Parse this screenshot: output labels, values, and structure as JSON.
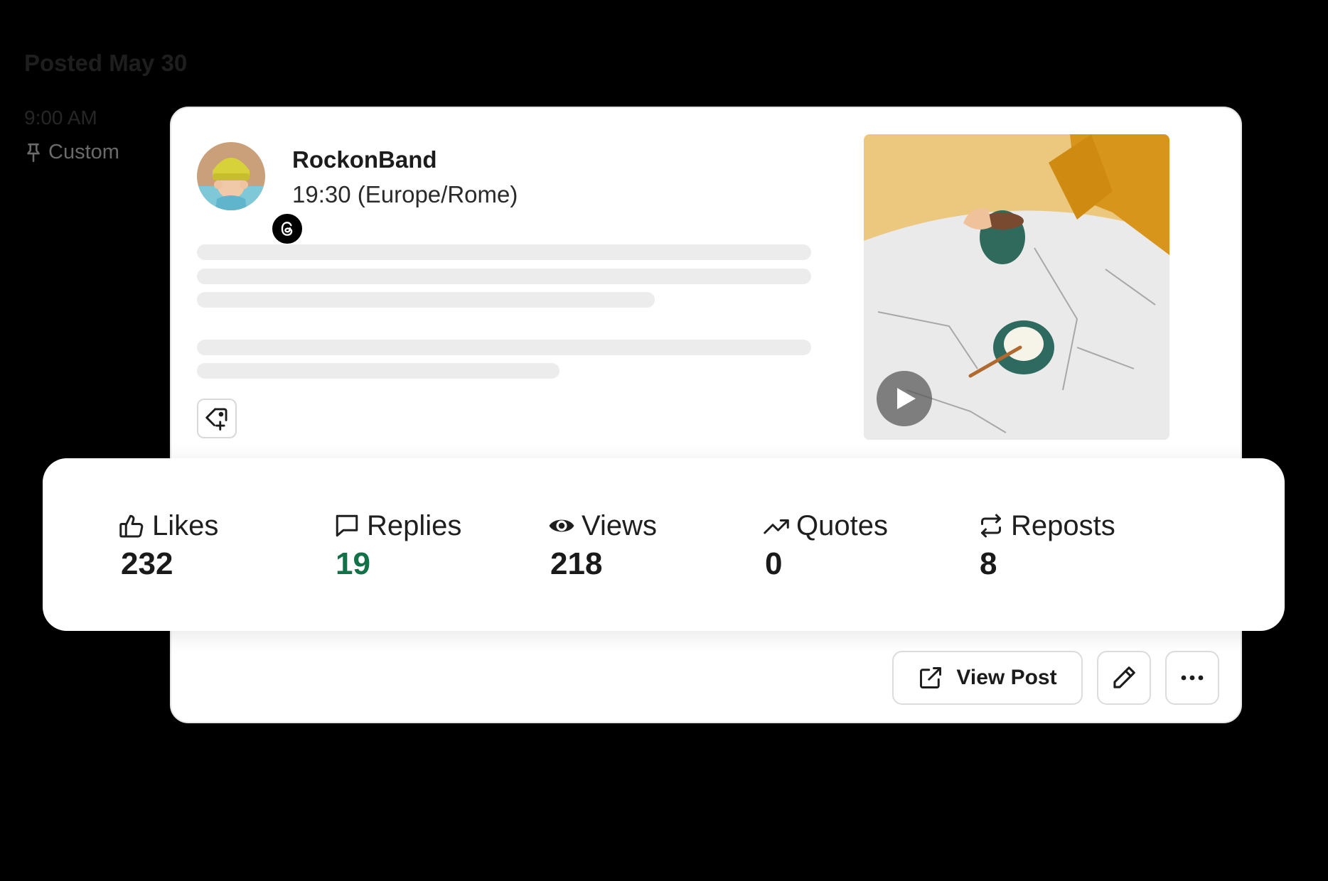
{
  "schedule": {
    "date_label": "Posted May 30",
    "time_label": "9:00 AM",
    "mode_label": "Custom"
  },
  "post": {
    "account_name": "RockonBand",
    "scheduled_time": "19:30 (Europe/Rome)",
    "platform": "threads",
    "media_type": "video"
  },
  "stats": {
    "likes": {
      "label": "Likes",
      "value": "232",
      "icon": "thumbs-up-icon"
    },
    "replies": {
      "label": "Replies",
      "value": "19",
      "icon": "comment-icon"
    },
    "views": {
      "label": "Views",
      "value": "218",
      "icon": "eye-icon"
    },
    "quotes": {
      "label": "Quotes",
      "value": "0",
      "icon": "trending-up-icon"
    },
    "reposts": {
      "label": "Reposts",
      "value": "8",
      "icon": "repost-icon"
    }
  },
  "actions": {
    "view_post_label": "View Post"
  },
  "colors": {
    "accent_green": "#137148",
    "background": "#000000",
    "card": "#ffffff",
    "skeleton": "#ececec"
  }
}
